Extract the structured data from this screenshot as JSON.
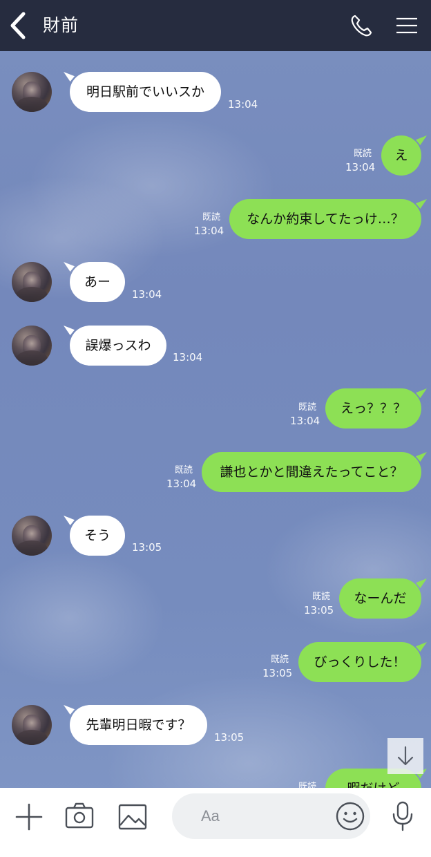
{
  "header": {
    "title": "財前",
    "back_icon": "back-chevron-icon",
    "call_icon": "phone-icon",
    "menu_icon": "hamburger-menu-icon"
  },
  "messages": [
    {
      "dir": "in",
      "text": "明日駅前でいいスか",
      "time": "13:04"
    },
    {
      "dir": "out",
      "text": "え",
      "time": "13:04",
      "read": "既読"
    },
    {
      "dir": "out",
      "text": "なんか約束してたっけ…？",
      "time": "13:04",
      "read": "既読"
    },
    {
      "dir": "in",
      "text": "あー",
      "time": "13:04"
    },
    {
      "dir": "in",
      "text": "誤爆っスわ",
      "time": "13:04"
    },
    {
      "dir": "out",
      "text": "えっ？？？",
      "time": "13:04",
      "read": "既読"
    },
    {
      "dir": "out",
      "text": "謙也とかと間違えたってこと？",
      "time": "13:04",
      "read": "既読"
    },
    {
      "dir": "in",
      "text": "そう",
      "time": "13:05"
    },
    {
      "dir": "out",
      "text": "なーんだ",
      "time": "13:05",
      "read": "既読"
    },
    {
      "dir": "out",
      "text": "びっくりした！",
      "time": "13:05",
      "read": "既読"
    },
    {
      "dir": "in",
      "text": "先輩明日暇です？",
      "time": "13:05"
    },
    {
      "dir": "out",
      "text": "暇だけど",
      "read": "既読"
    }
  ],
  "bottom_bar": {
    "input_placeholder": "Aa",
    "icons": [
      "plus-icon",
      "camera-icon",
      "image-icon",
      "emoji-icon",
      "microphone-icon"
    ]
  },
  "scroll_down_icon": "arrow-down-icon",
  "colors": {
    "header_bg": "#262c3f",
    "chat_bg": "#7a8fbf",
    "outgoing_bubble": "#8de055",
    "incoming_bubble": "#ffffff"
  }
}
